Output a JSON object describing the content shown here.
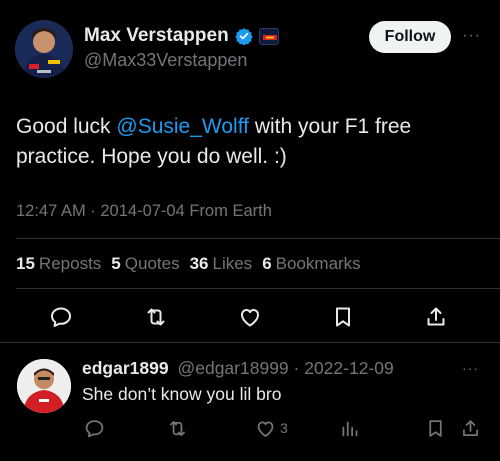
{
  "author": {
    "name": "Max Verstappen",
    "handle": "@Max33Verstappen"
  },
  "follow_label": "Follow",
  "more_label": "···",
  "tweet": {
    "text_before": "Good luck ",
    "mention": "@Susie_Wolff",
    "text_after": " with your F1 free practice. Hope you do well. :)",
    "meta": "12:47 AM · 2014-07-04 From Earth"
  },
  "stats": [
    {
      "count": "15",
      "label": "Reposts"
    },
    {
      "count": "5",
      "label": "Quotes"
    },
    {
      "count": "36",
      "label": "Likes"
    },
    {
      "count": "6",
      "label": "Bookmarks"
    }
  ],
  "reply": {
    "name": "edgar1899",
    "handle": "@edgar18999",
    "date": "· 2022-12-09",
    "text": "She don’t know you lil bro",
    "like_count": "3"
  },
  "icons": {
    "verified": "verified-badge-icon",
    "reply": "reply-icon",
    "repost": "repost-icon",
    "like": "heart-icon",
    "bookmark": "bookmark-icon",
    "share": "share-icon",
    "views": "views-icon"
  },
  "colors": {
    "background": "#000000",
    "text": "#e7e9ea",
    "muted": "#71767b",
    "link": "#1d9bf0",
    "divider": "#2f3336",
    "follow_bg": "#eff3f4"
  }
}
